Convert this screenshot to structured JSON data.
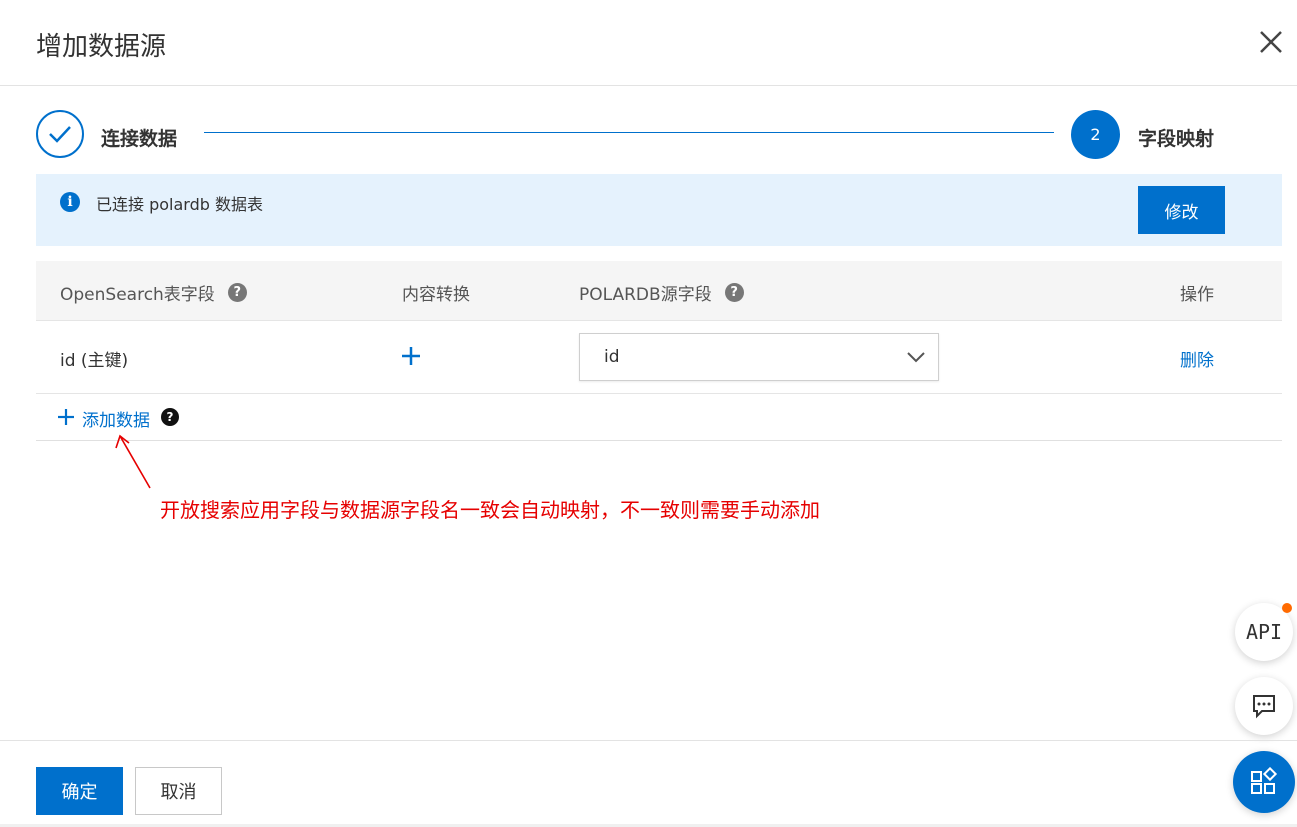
{
  "dialog": {
    "title": "增加数据源",
    "close_icon": "close-icon"
  },
  "steps": [
    {
      "label": "连接数据",
      "status": "done",
      "icon": "check-icon"
    },
    {
      "label": "字段映射",
      "status": "active",
      "number": "2"
    }
  ],
  "banner": {
    "icon": "info-icon",
    "text": "已连接 polardb 数据表",
    "button_label": "修改"
  },
  "table": {
    "headers": [
      "OpenSearch表字段",
      "内容转换",
      "POLARDB源字段",
      "操作"
    ],
    "rows": [
      {
        "field": "id (主键)",
        "source_field": "id",
        "action": "删除"
      }
    ],
    "add_label": "添加数据"
  },
  "annotation": {
    "text": "开放搜索应用字段与数据源字段名一致会自动映射，不一致则需要手动添加",
    "color": "#e60000"
  },
  "floating": {
    "api_label": "API",
    "icons": [
      "api-icon",
      "chat-icon",
      "apps-icon"
    ]
  },
  "footer": {
    "ok_label": "确定",
    "cancel_label": "取消"
  },
  "colors": {
    "primary": "#0070cc",
    "banner_bg": "#e5f2fd",
    "badge": "#ff6a00"
  }
}
